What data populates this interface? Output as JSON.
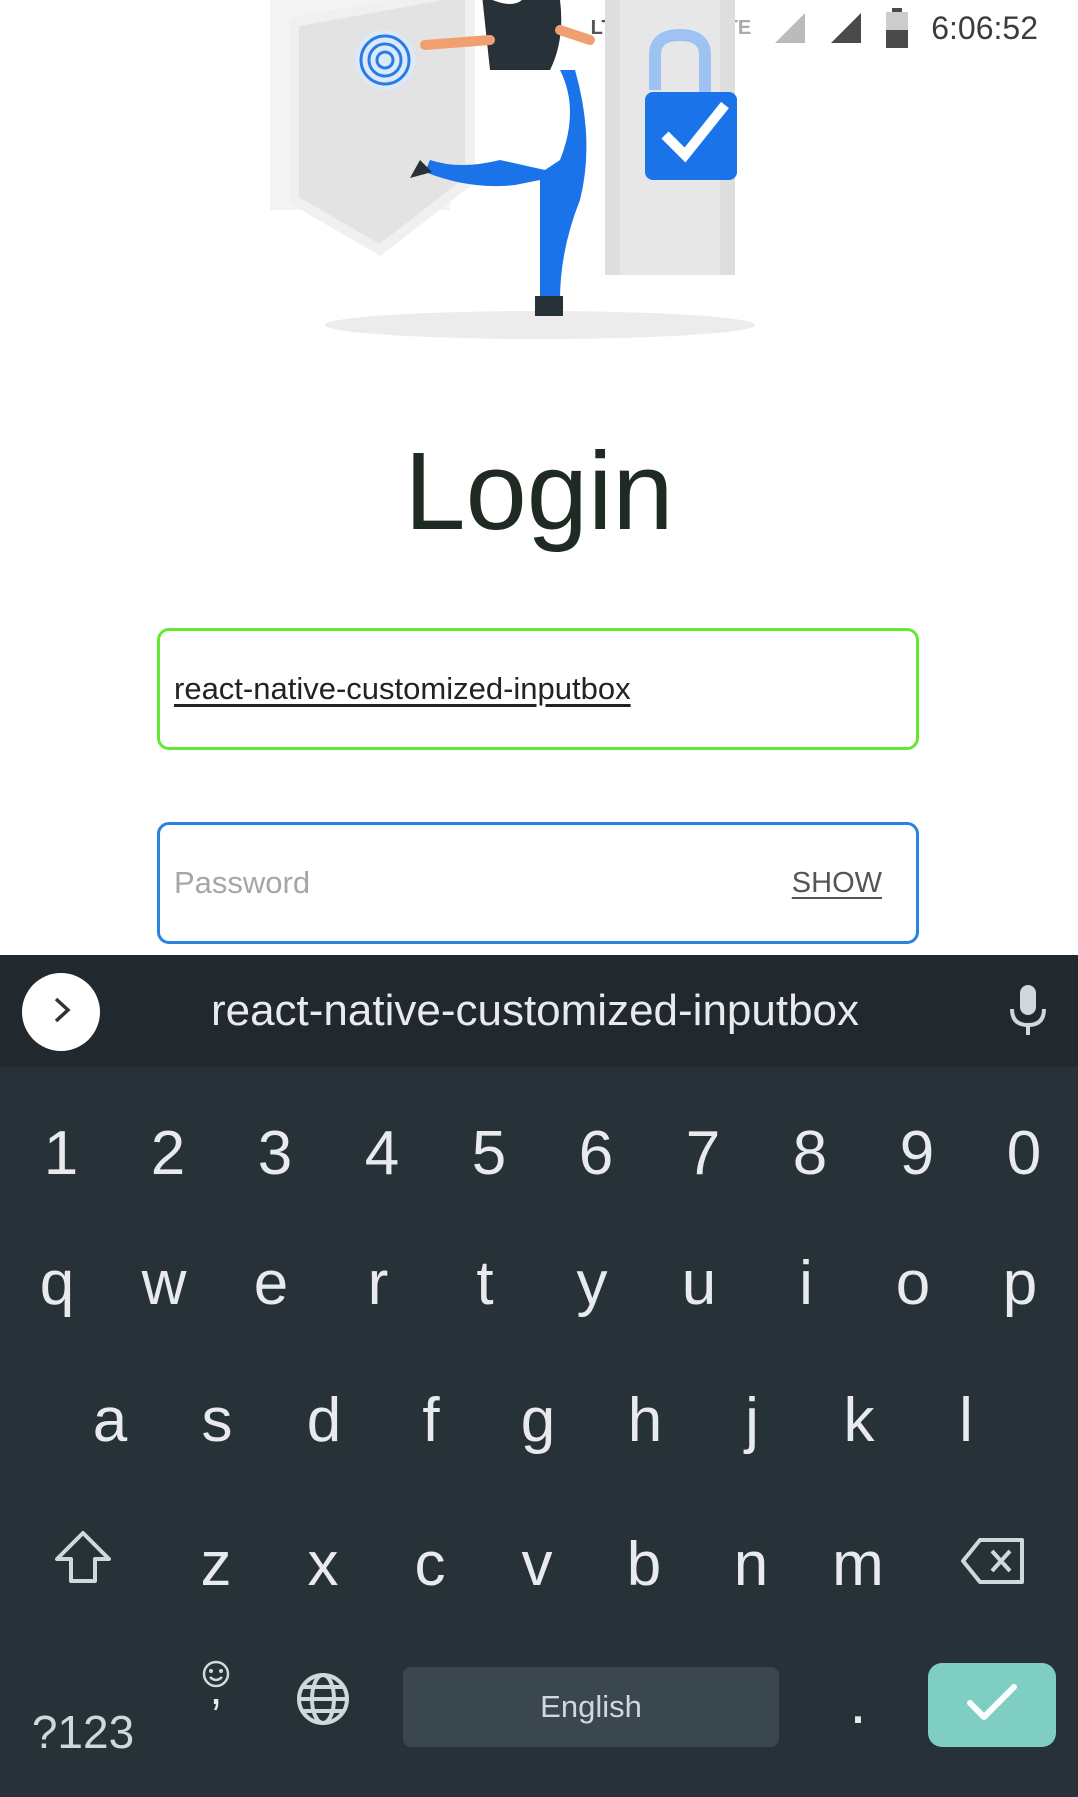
{
  "status_bar": {
    "time": "6:06:52",
    "network_label_1": "LTE",
    "network_label_2": "LTE"
  },
  "login": {
    "title": "Login",
    "username_value": "react-native-customized-inputbox",
    "password_placeholder": "Password",
    "show_label": "SHOW",
    "username_border_color": "#64e834",
    "password_border_color": "#2b82e0"
  },
  "keyboard": {
    "suggestion": "react-native-customized-inputbox",
    "number_row": [
      "1",
      "2",
      "3",
      "4",
      "5",
      "6",
      "7",
      "8",
      "9",
      "0"
    ],
    "row1": [
      "q",
      "w",
      "e",
      "r",
      "t",
      "y",
      "u",
      "i",
      "o",
      "p"
    ],
    "row2": [
      "a",
      "s",
      "d",
      "f",
      "g",
      "h",
      "j",
      "k",
      "l"
    ],
    "row3": [
      "z",
      "x",
      "c",
      "v",
      "b",
      "n",
      "m"
    ],
    "symbols_label": "?123",
    "comma_label": ",",
    "space_label": "English",
    "period_label": ".",
    "icons": [
      "chevron-right-icon",
      "mic-icon",
      "shift-icon",
      "backspace-icon",
      "emoji-icon",
      "globe-icon",
      "check-icon"
    ],
    "enter_color": "#7ecec4"
  }
}
